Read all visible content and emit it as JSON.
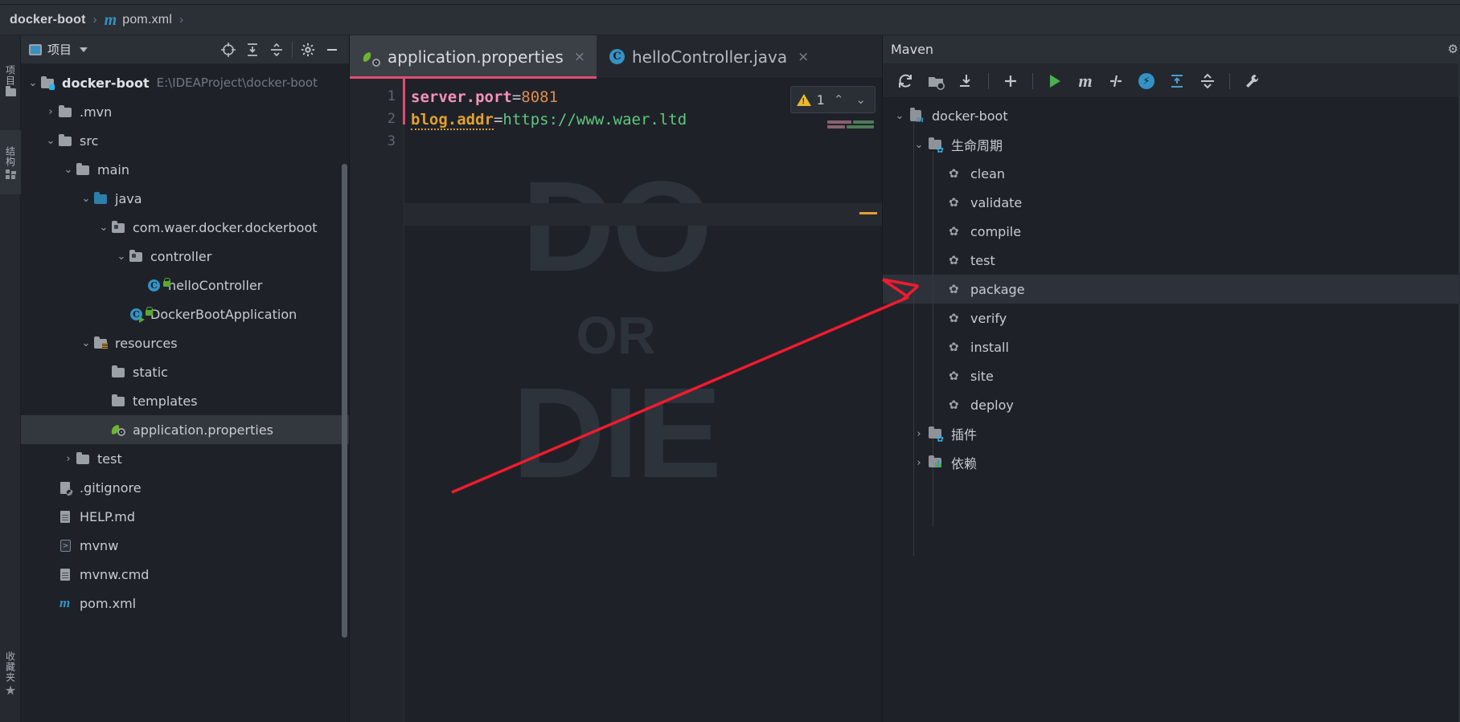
{
  "breadcrumb": {
    "project": "docker-boot",
    "sep": "›",
    "file": "pom.xml",
    "file_icon": "maven-m-icon"
  },
  "left_rail": {
    "items": [
      {
        "label": "项目",
        "icon": "project-icon"
      },
      {
        "label": "结构",
        "icon": "structure-icon"
      },
      {
        "label": "收藏夹",
        "icon": "favorites-star-icon"
      }
    ]
  },
  "project_panel": {
    "title": "项目",
    "toolbar": [
      {
        "name": "select-opened-file-icon",
        "glyph": "⊕"
      },
      {
        "name": "expand-all-icon",
        "glyph": "⤓"
      },
      {
        "name": "collapse-all-icon",
        "glyph": "⤒"
      },
      {
        "name": "settings-gear-icon",
        "glyph": "⚙"
      },
      {
        "name": "hide-panel-icon",
        "glyph": "—"
      }
    ],
    "tree": [
      {
        "label": "docker-boot",
        "path": "E:\\IDEAProject\\docker-boot",
        "indent": 0,
        "arrow": "v",
        "icon": "module-folder-icon",
        "selected": false,
        "bold": true
      },
      {
        "label": ".mvn",
        "path": "",
        "indent": 1,
        "arrow": ">",
        "icon": "folder-icon",
        "selected": false,
        "bold": false
      },
      {
        "label": "src",
        "path": "",
        "indent": 1,
        "arrow": "v",
        "icon": "folder-icon",
        "selected": false,
        "bold": false
      },
      {
        "label": "main",
        "path": "",
        "indent": 2,
        "arrow": "v",
        "icon": "folder-icon",
        "selected": false,
        "bold": false
      },
      {
        "label": "java",
        "path": "",
        "indent": 3,
        "arrow": "v",
        "icon": "source-folder-icon",
        "selected": false,
        "bold": false
      },
      {
        "label": "com.waer.docker.dockerboot",
        "path": "",
        "indent": 4,
        "arrow": "v",
        "icon": "package-icon",
        "selected": false,
        "bold": false
      },
      {
        "label": "controller",
        "path": "",
        "indent": 5,
        "arrow": "v",
        "icon": "package-icon",
        "selected": false,
        "bold": false
      },
      {
        "label": "helloController",
        "path": "",
        "indent": 6,
        "arrow": "",
        "icon": "java-class-icon",
        "selected": false,
        "bold": false
      },
      {
        "label": "DockerBootApplication",
        "path": "",
        "indent": 5,
        "arrow": "",
        "icon": "java-runnable-class-icon",
        "selected": false,
        "bold": false
      },
      {
        "label": "resources",
        "path": "",
        "indent": 3,
        "arrow": "v",
        "icon": "resources-folder-icon",
        "selected": false,
        "bold": false
      },
      {
        "label": "static",
        "path": "",
        "indent": 4,
        "arrow": "",
        "icon": "folder-icon",
        "selected": false,
        "bold": false
      },
      {
        "label": "templates",
        "path": "",
        "indent": 4,
        "arrow": "",
        "icon": "folder-icon",
        "selected": false,
        "bold": false
      },
      {
        "label": "application.properties",
        "path": "",
        "indent": 4,
        "arrow": "",
        "icon": "spring-properties-icon",
        "selected": true,
        "bold": false
      },
      {
        "label": "test",
        "path": "",
        "indent": 2,
        "arrow": ">",
        "icon": "folder-icon",
        "selected": false,
        "bold": false
      },
      {
        "label": ".gitignore",
        "path": "",
        "indent": 1,
        "arrow": "",
        "icon": "gitignore-file-icon",
        "selected": false,
        "bold": false
      },
      {
        "label": "HELP.md",
        "path": "",
        "indent": 1,
        "arrow": "",
        "icon": "markdown-file-icon",
        "selected": false,
        "bold": false
      },
      {
        "label": "mvnw",
        "path": "",
        "indent": 1,
        "arrow": "",
        "icon": "shell-script-icon",
        "selected": false,
        "bold": false
      },
      {
        "label": "mvnw.cmd",
        "path": "",
        "indent": 1,
        "arrow": "",
        "icon": "cmd-script-icon",
        "selected": false,
        "bold": false
      },
      {
        "label": "pom.xml",
        "path": "",
        "indent": 1,
        "arrow": "",
        "icon": "maven-m-icon",
        "selected": false,
        "bold": false
      }
    ]
  },
  "editor": {
    "tabs": [
      {
        "label": "application.properties",
        "icon": "spring-properties-icon",
        "active": true,
        "close": "×"
      },
      {
        "label": "helloController.java",
        "icon": "java-class-icon",
        "active": false,
        "close": "×"
      }
    ],
    "lines": [
      {
        "number": "1",
        "tokens": [
          {
            "text": "server.port",
            "style": "k-key"
          },
          {
            "text": "=",
            "style": "k-eq"
          },
          {
            "text": "8081",
            "style": "k-num"
          }
        ]
      },
      {
        "number": "2",
        "tokens": [
          {
            "text": "blog.addr",
            "style": "k-key2"
          },
          {
            "text": "=",
            "style": "k-eq"
          },
          {
            "text": "https://www.waer.ltd",
            "style": "k-str"
          }
        ]
      },
      {
        "number": "3",
        "tokens": []
      }
    ],
    "watermark": {
      "line1": "DO",
      "line2": "OR",
      "line3": "DIE"
    },
    "inspection": {
      "warning_count": "1",
      "prev_glyph": "⌃",
      "next_glyph": "⌄",
      "icon": "warning-triangle-icon"
    }
  },
  "maven": {
    "title": "Maven",
    "toolbar": [
      {
        "name": "reload-all-projects-icon",
        "glyph": "⟳"
      },
      {
        "name": "add-maven-project-folder-icon",
        "glyph": "🗀"
      },
      {
        "name": "download-sources-icon",
        "glyph": "⤓"
      },
      {
        "name": "add-icon",
        "glyph": "+"
      },
      {
        "name": "run-maven-build-icon",
        "glyph": "▶"
      },
      {
        "name": "execute-maven-goal-icon",
        "glyph": "m"
      },
      {
        "name": "toggle-skip-tests-icon",
        "glyph": "⫝̸"
      },
      {
        "name": "toggle-offline-mode-icon",
        "glyph": "⚡"
      },
      {
        "name": "expand-all-icon",
        "glyph": "⤓"
      },
      {
        "name": "collapse-all-icon",
        "glyph": "⤒"
      },
      {
        "name": "maven-settings-icon",
        "glyph": "🔧"
      }
    ],
    "tree": [
      {
        "label": "docker-boot",
        "indent": 0,
        "arrow": "v",
        "icon": "maven-project-icon",
        "selected": false
      },
      {
        "label": "生命周期",
        "indent": 1,
        "arrow": "v",
        "icon": "lifecycle-folder-icon",
        "selected": false
      },
      {
        "label": "clean",
        "indent": 2,
        "arrow": "",
        "icon": "maven-goal-gear-icon",
        "selected": false
      },
      {
        "label": "validate",
        "indent": 2,
        "arrow": "",
        "icon": "maven-goal-gear-icon",
        "selected": false
      },
      {
        "label": "compile",
        "indent": 2,
        "arrow": "",
        "icon": "maven-goal-gear-icon",
        "selected": false
      },
      {
        "label": "test",
        "indent": 2,
        "arrow": "",
        "icon": "maven-goal-gear-icon",
        "selected": false
      },
      {
        "label": "package",
        "indent": 2,
        "arrow": "",
        "icon": "maven-goal-gear-icon",
        "selected": true
      },
      {
        "label": "verify",
        "indent": 2,
        "arrow": "",
        "icon": "maven-goal-gear-icon",
        "selected": false
      },
      {
        "label": "install",
        "indent": 2,
        "arrow": "",
        "icon": "maven-goal-gear-icon",
        "selected": false
      },
      {
        "label": "site",
        "indent": 2,
        "arrow": "",
        "icon": "maven-goal-gear-icon",
        "selected": false
      },
      {
        "label": "deploy",
        "indent": 2,
        "arrow": "",
        "icon": "maven-goal-gear-icon",
        "selected": false
      },
      {
        "label": "插件",
        "indent": 1,
        "arrow": ">",
        "icon": "plugins-folder-icon",
        "selected": false
      },
      {
        "label": "依赖",
        "indent": 1,
        "arrow": ">",
        "icon": "dependencies-folder-icon",
        "selected": false
      }
    ]
  },
  "annotation": {
    "type": "red-arrow",
    "color": "#f21a2e",
    "points_to": "package"
  },
  "colors": {
    "accent_blue": "#3592c4",
    "tab_underline": "#e04d71",
    "warning_yellow": "#e8b931",
    "string_green": "#5ec77e",
    "key_pink": "#f792b6",
    "annotation_red": "#f21a2e"
  }
}
